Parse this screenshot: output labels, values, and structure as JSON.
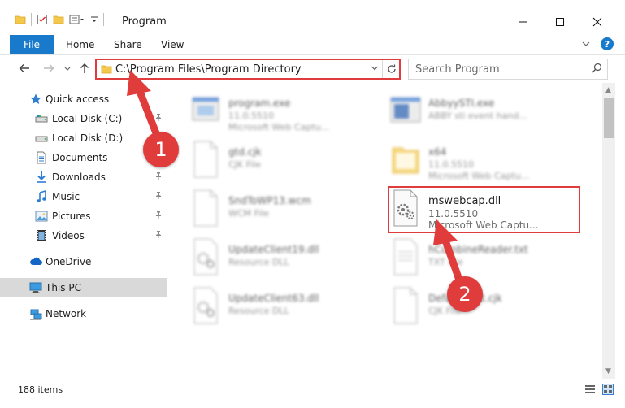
{
  "window": {
    "title": "Program",
    "minimize_icon": "minimize-icon",
    "maximize_icon": "maximize-icon",
    "close_icon": "close-icon"
  },
  "ribbon": {
    "tabs": [
      {
        "label": "File"
      },
      {
        "label": "Home"
      },
      {
        "label": "Share"
      },
      {
        "label": "View"
      }
    ]
  },
  "address_bar": {
    "path": "C:\\Program Files\\Program Directory"
  },
  "search": {
    "placeholder": "Search Program"
  },
  "sidebar": {
    "quick_access": "Quick access",
    "items": [
      {
        "label": "Local Disk (C:)",
        "icon": "drive-icon",
        "pinned": true
      },
      {
        "label": "Local Disk (D:)",
        "icon": "drive-icon",
        "pinned": false
      },
      {
        "label": "Documents",
        "icon": "documents-icon",
        "pinned": true
      },
      {
        "label": "Downloads",
        "icon": "downloads-icon",
        "pinned": true
      },
      {
        "label": "Music",
        "icon": "music-icon",
        "pinned": true
      },
      {
        "label": "Pictures",
        "icon": "pictures-icon",
        "pinned": true
      },
      {
        "label": "Videos",
        "icon": "videos-icon",
        "pinned": true
      }
    ],
    "onedrive": "OneDrive",
    "this_pc": "This PC",
    "network": "Network"
  },
  "files": [
    {
      "name": "program.exe",
      "line2": "11.0.5510",
      "line3": "Microsoft Web Captu...",
      "icon": "exe-icon"
    },
    {
      "name": "AbbyySTI.exe",
      "line2": "ABBY sti event hand...",
      "line3": "",
      "icon": "exe-icon"
    },
    {
      "name": "gtd.cjk",
      "line2": "CJK File",
      "line3": "",
      "icon": "file-icon"
    },
    {
      "name": "x64",
      "line2": "11.0.5510",
      "line3": "Microsoft Web Captu...",
      "icon": "folder-icon"
    },
    {
      "name": "SndToWP13.wcm",
      "line2": "WCM File",
      "line3": "",
      "icon": "file-icon"
    },
    {
      "name": "mswebcap.dll",
      "line2": "11.0.5510",
      "line3": "Microsoft Web Captu...",
      "icon": "dll-icon"
    },
    {
      "name": "UpdateClient19.dll",
      "line2": "Resource DLL",
      "line3": "",
      "icon": "dll-icon"
    },
    {
      "name": "hCombineReader.txt",
      "line2": "TXT File",
      "line3": "",
      "icon": "text-file-icon"
    },
    {
      "name": "UpdateClient63.dll",
      "line2": "Resource DLL",
      "line3": "",
      "icon": "dll-icon"
    },
    {
      "name": "DefaultFont.cjk",
      "line2": "CJK File",
      "line3": "",
      "icon": "file-icon"
    }
  ],
  "status": {
    "item_count": "188 items"
  },
  "annotations": {
    "step1": "1",
    "step2": "2",
    "color": "#e03c3c"
  },
  "colors": {
    "accent": "#1979ca",
    "highlight": "#e03c3c"
  }
}
